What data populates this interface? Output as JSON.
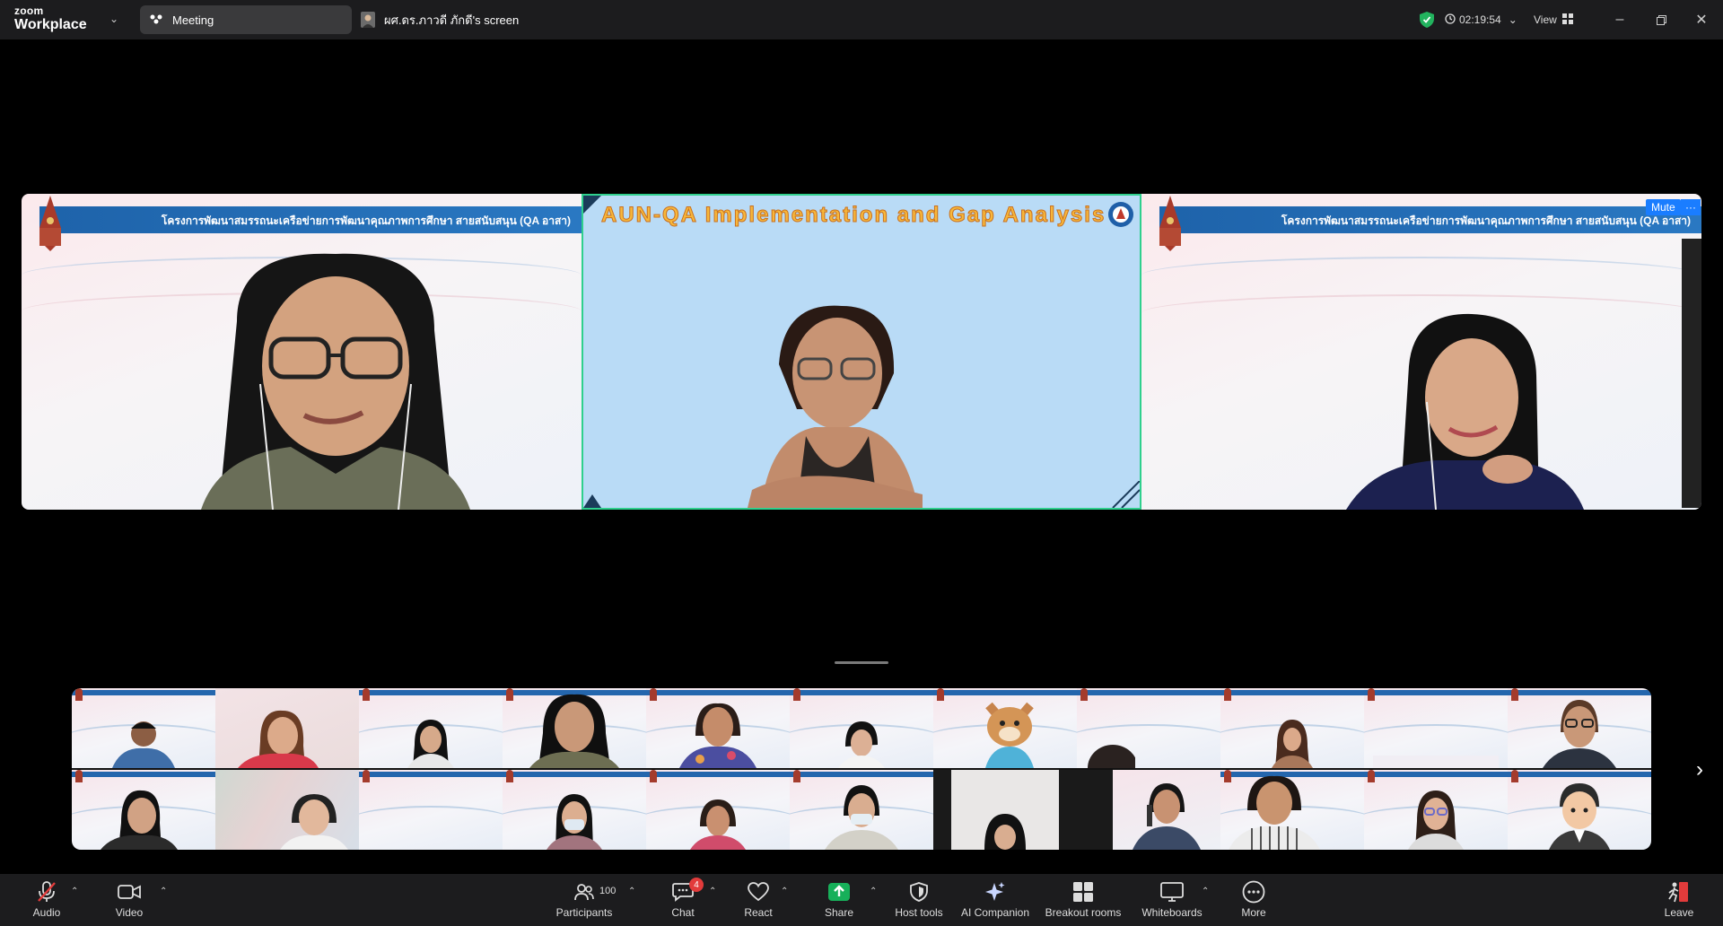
{
  "app": {
    "brand_small": "zoom",
    "brand_name": "Workplace"
  },
  "tabs": {
    "meeting": "Meeting",
    "screen_share": "ผศ.ดร.ภาวดี ภักดี's screen"
  },
  "header": {
    "timer": "02:19:54",
    "view_label": "View"
  },
  "slides": {
    "banner_text": "โครงการพัฒนาสมรรถนะเครือข่ายการพัฒนาคุณภาพการศึกษา สายสนับสนุน (QA อาสา)",
    "center_title": "AUN-QA Implementation and Gap Analysis"
  },
  "speaker_controls": {
    "mute_label": "Mute",
    "more_label": "···"
  },
  "gallery": {
    "rows": 2,
    "columns": 11
  },
  "toolbar": {
    "audio": "Audio",
    "video": "Video",
    "participants": "Participants",
    "participants_count": "100",
    "chat": "Chat",
    "chat_badge": "4",
    "react": "React",
    "share": "Share",
    "host_tools": "Host tools",
    "ai_companion": "AI Companion",
    "breakout_rooms": "Breakout rooms",
    "whiteboards": "Whiteboards",
    "more": "More",
    "leave": "Leave"
  },
  "colors": {
    "share_green": "#17b05a",
    "mute_red": "#e23b3b",
    "active_speaker_border": "#2fd08d",
    "banner_blue": "#1e63aa"
  }
}
